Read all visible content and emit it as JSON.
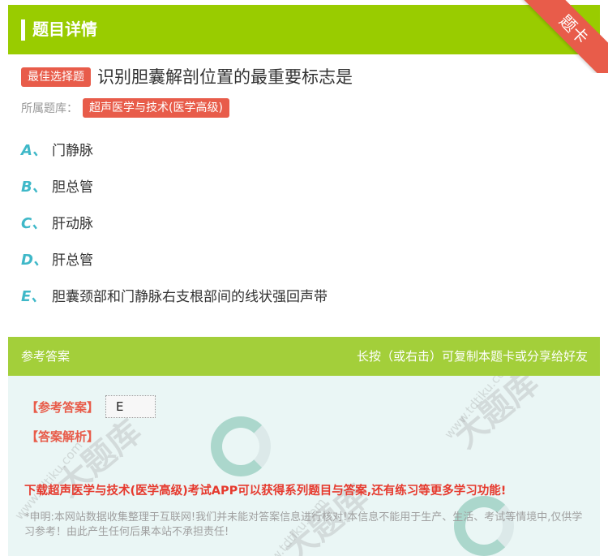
{
  "header": {
    "title": "题目详情",
    "ribbon": "题卡"
  },
  "question": {
    "type_badge": "最佳选择题",
    "text": "识别胆囊解剖位置的最重要标志是",
    "bank_label": "所属题库：",
    "bank_name": "超声医学与技术(医学高级)"
  },
  "options": [
    {
      "letter": "A、",
      "text": "门静脉"
    },
    {
      "letter": "B、",
      "text": "胆总管"
    },
    {
      "letter": "C、",
      "text": "肝动脉"
    },
    {
      "letter": "D、",
      "text": "肝总管"
    },
    {
      "letter": "E、",
      "text": "胆囊颈部和门静脉右支根部间的线状强回声带"
    }
  ],
  "answer": {
    "section_title": "参考答案",
    "copy_hint": "长按（或右击）可复制本题卡或分享给好友",
    "answer_tag": "【参考答案】",
    "answer_value": "E",
    "explanation_tag": "【答案解析】",
    "promo": "下载超声医学与技术(医学高级)考试APP可以获得系列题目与答案,还有练习等更多学习功能!",
    "disclaimer": "*申明:本网站数据收集整理于互联网!我们并未能对答案信息进行核对!本信息不能用于生产、生活、考试等情境中,仅供学习参考！由此产生任何后果本站不承担责任!"
  },
  "watermark": {
    "text": "大题库",
    "url": "www.tdtiku.com"
  }
}
